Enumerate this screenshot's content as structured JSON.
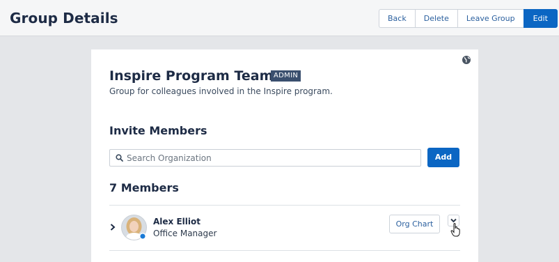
{
  "header": {
    "title": "Group Details",
    "actions": {
      "back": "Back",
      "delete": "Delete",
      "leave": "Leave Group",
      "edit": "Edit"
    }
  },
  "group": {
    "name": "Inspire Program Team",
    "badge": "ADMIN",
    "description": "Group for colleagues involved in the Inspire program.",
    "visibility_icon": "globe-icon"
  },
  "invite": {
    "heading": "Invite Members",
    "search_placeholder": "Search Organization",
    "add_label": "Add"
  },
  "members": {
    "heading": "7 Members",
    "items": [
      {
        "name": "Alex Elliot",
        "role": "Office Manager",
        "org_chart_label": "Org Chart"
      }
    ]
  },
  "colors": {
    "primary": "#0b66c3",
    "heading": "#1d2b45",
    "badge_bg": "#3a4f6e",
    "link": "#2a5f9e"
  }
}
